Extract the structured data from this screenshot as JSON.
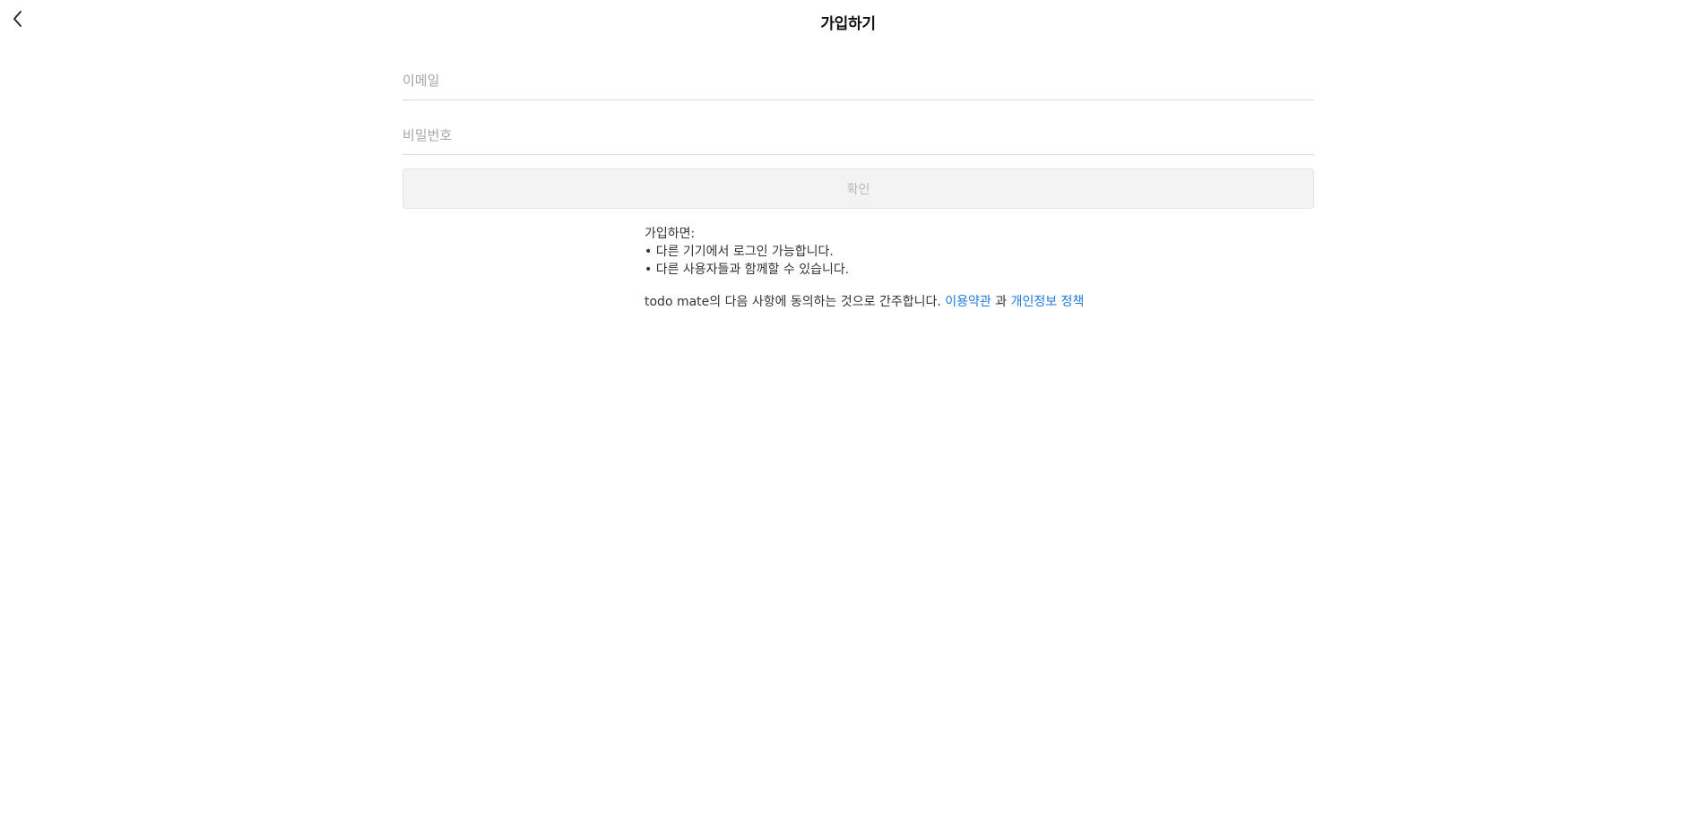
{
  "header": {
    "title": "가입하기",
    "back_icon": "chevron-left-icon"
  },
  "form": {
    "email": {
      "placeholder": "이메일",
      "value": ""
    },
    "password": {
      "placeholder": "비밀번호",
      "value": ""
    },
    "confirm_label": "확인"
  },
  "notice": {
    "heading": "가입하면:",
    "bullets": [
      "• 다른 기기에서 로그인 가능합니다.",
      "• 다른 사용자들과 함께할 수 있습니다."
    ],
    "agreement_prefix": "todo mate의 다음 사항에 동의하는 것으로 간주합니다.",
    "terms_link": "이용약관",
    "conjunction": "과",
    "privacy_link": "개인정보 정책"
  },
  "colors": {
    "link": "#1f7ae0",
    "button_bg": "#f3f3f3",
    "button_text": "#b8b8b8",
    "placeholder": "#a6a6a6"
  }
}
